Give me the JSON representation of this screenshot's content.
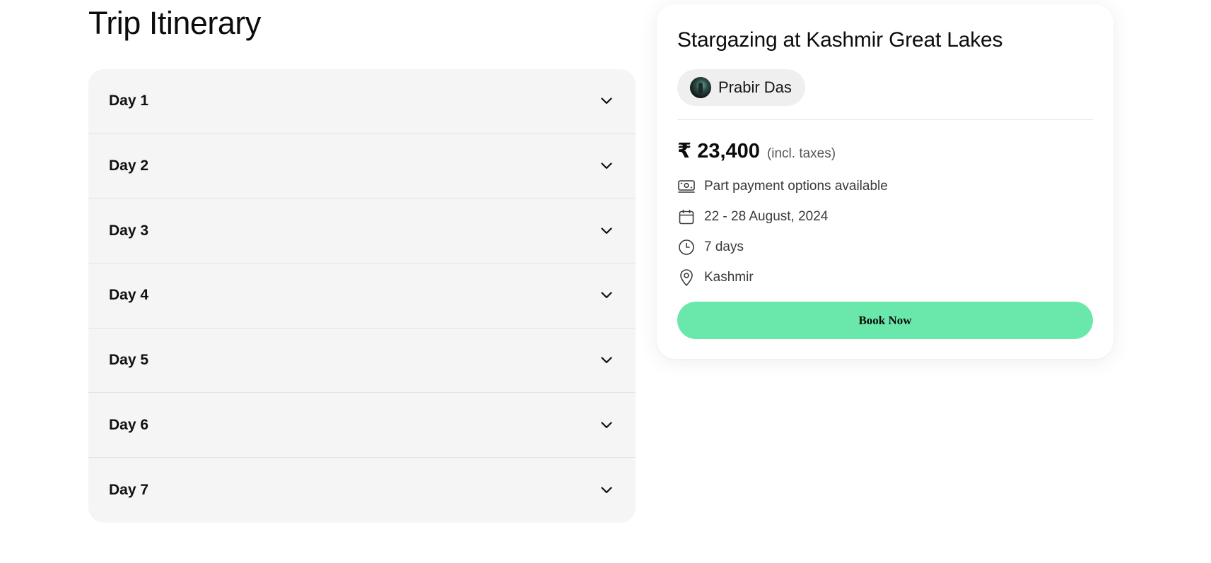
{
  "itinerary": {
    "title": "Trip Itinerary",
    "days": [
      {
        "label": "Day 1"
      },
      {
        "label": "Day 2"
      },
      {
        "label": "Day 3"
      },
      {
        "label": "Day 4"
      },
      {
        "label": "Day 5"
      },
      {
        "label": "Day 6"
      },
      {
        "label": "Day 7"
      }
    ]
  },
  "card": {
    "title": "Stargazing at Kashmir Great Lakes",
    "host": {
      "name": "Prabir Das"
    },
    "price": {
      "amount": "₹ 23,400",
      "note": "(incl. taxes)"
    },
    "details": [
      {
        "icon": "money-icon",
        "text": "Part payment options available"
      },
      {
        "icon": "calendar-icon",
        "text": "22 - 28 August, 2024"
      },
      {
        "icon": "clock-icon",
        "text": "7 days"
      },
      {
        "icon": "location-pin-icon",
        "text": "Kashmir"
      }
    ],
    "cta_label": "Book Now"
  },
  "colors": {
    "cta": "#6ae8ab",
    "accordion_bg": "#f5f5f5",
    "chip_bg": "#efefef"
  }
}
